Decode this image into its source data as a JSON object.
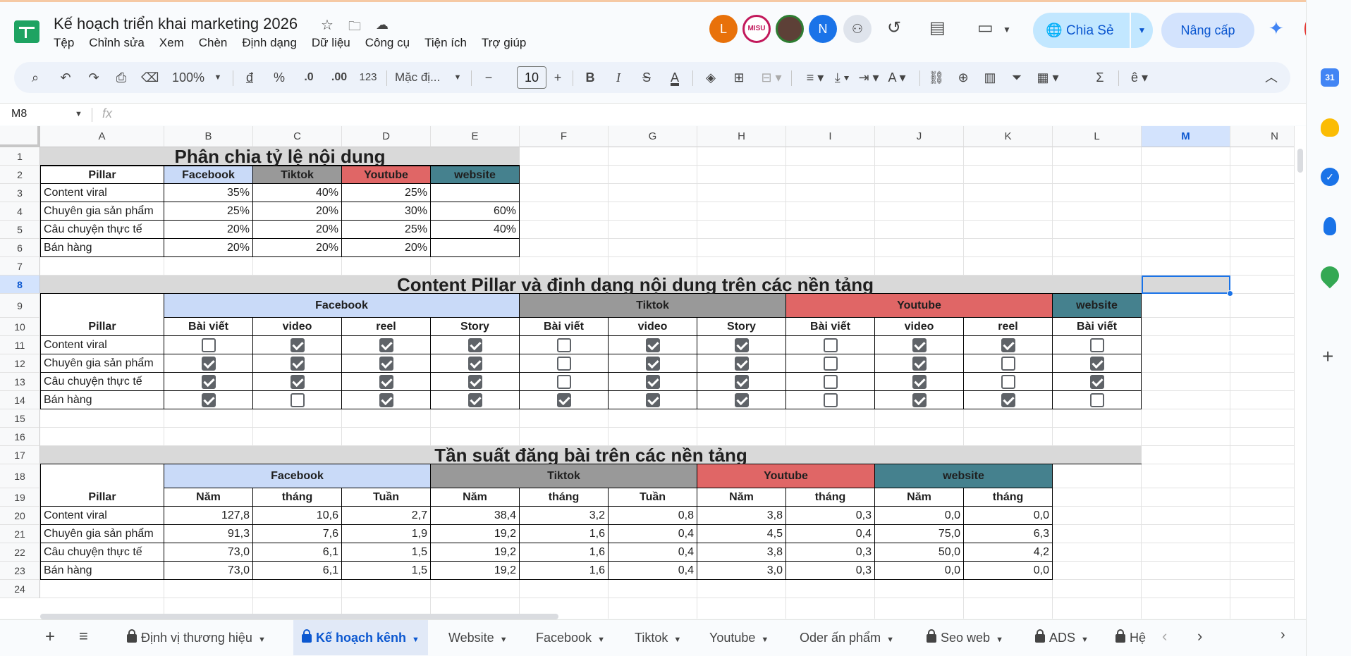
{
  "doc": {
    "title": "Kế hoạch triển khai marketing 2026"
  },
  "menu": [
    "Tệp",
    "Chỉnh sửa",
    "Xem",
    "Chèn",
    "Định dạng",
    "Dữ liệu",
    "Công cụ",
    "Tiện ích",
    "Trợ giúp"
  ],
  "avatars": [
    {
      "label": "L",
      "color": "#e8710a"
    },
    {
      "label": "MISU",
      "color": "#c2185b"
    },
    {
      "label": "",
      "color": "#5d4037"
    },
    {
      "label": "N",
      "color": "#1a73e8"
    }
  ],
  "share": {
    "label": "Chia Sẻ"
  },
  "upgrade": {
    "label": "Nâng cấp"
  },
  "toolbar": {
    "zoom": "100%",
    "currency": "đ",
    "percent": "%",
    "dec_less": ".0",
    "dec_more": ".00",
    "format123": "123",
    "font": "Mặc đị...",
    "font_size": "10"
  },
  "namebox": "M8",
  "fx": "fx",
  "columns": [
    "A",
    "B",
    "C",
    "D",
    "E",
    "F",
    "G",
    "H",
    "I",
    "J",
    "K",
    "L",
    "M",
    "N"
  ],
  "selected": {
    "col": "M",
    "row": "8"
  },
  "colors": {
    "facebook": "#c9daf8",
    "tiktok": "#999999",
    "youtube": "#e06666",
    "website": "#45818e",
    "title": "#d9d9d9",
    "accent": "#1a73e8"
  },
  "table1": {
    "title": "Phân chia tỷ lệ nội dung",
    "headers": [
      "Pillar",
      "Facebook",
      "Tiktok",
      "Youtube",
      "website"
    ],
    "rows": [
      [
        "Content viral",
        "35%",
        "40%",
        "25%",
        ""
      ],
      [
        "Chuyên gia sản phẩm",
        "25%",
        "20%",
        "30%",
        "60%"
      ],
      [
        "Câu chuyện thực tế",
        "20%",
        "20%",
        "25%",
        "40%"
      ],
      [
        "Bán hàng",
        "20%",
        "20%",
        "20%",
        ""
      ]
    ]
  },
  "table2": {
    "title": "Content Pillar và định dạng nội dung trên các nền tảng",
    "pillar": "Pillar",
    "platforms": [
      "Facebook",
      "Tiktok",
      "Youtube",
      "website"
    ],
    "formats": [
      "Bài viết",
      "video",
      "reel",
      "Story",
      "Bài viết",
      "video",
      "Story",
      "Bài viết",
      "video",
      "reel",
      "Bài viết"
    ],
    "rows": [
      {
        "label": "Content viral",
        "checks": [
          0,
          1,
          1,
          1,
          0,
          1,
          1,
          0,
          1,
          1,
          0
        ]
      },
      {
        "label": "Chuyên gia sản phẩm",
        "checks": [
          1,
          1,
          1,
          1,
          0,
          1,
          1,
          0,
          1,
          0,
          1
        ]
      },
      {
        "label": "Câu chuyện thực tế",
        "checks": [
          1,
          1,
          1,
          1,
          0,
          1,
          1,
          0,
          1,
          0,
          1
        ]
      },
      {
        "label": "Bán hàng",
        "checks": [
          1,
          0,
          1,
          1,
          1,
          1,
          1,
          0,
          1,
          1,
          0
        ]
      }
    ]
  },
  "table3": {
    "title": "Tần suất đăng bài trên các nền tảng",
    "pillar": "Pillar",
    "platforms": [
      "Facebook",
      "Tiktok",
      "Youtube",
      "website"
    ],
    "periods": [
      "Năm",
      "tháng",
      "Tuần",
      "Năm",
      "tháng",
      "Tuần",
      "Năm",
      "tháng",
      "Năm",
      "tháng"
    ],
    "rows": [
      {
        "label": "Content viral",
        "values": [
          "127,8",
          "10,6",
          "2,7",
          "38,4",
          "3,2",
          "0,8",
          "3,8",
          "0,3",
          "0,0",
          "0,0"
        ]
      },
      {
        "label": "Chuyên gia sản phẩm",
        "values": [
          "91,3",
          "7,6",
          "1,9",
          "19,2",
          "1,6",
          "0,4",
          "4,5",
          "0,4",
          "75,0",
          "6,3"
        ]
      },
      {
        "label": "Câu chuyện thực tế",
        "values": [
          "73,0",
          "6,1",
          "1,5",
          "19,2",
          "1,6",
          "0,4",
          "3,8",
          "0,3",
          "50,0",
          "4,2"
        ]
      },
      {
        "label": "Bán hàng",
        "values": [
          "73,0",
          "6,1",
          "1,5",
          "19,2",
          "1,6",
          "0,4",
          "3,0",
          "0,3",
          "0,0",
          "0,0"
        ]
      }
    ]
  },
  "tabs": [
    {
      "label": "Định vị thương hiệu",
      "locked": true,
      "active": false
    },
    {
      "label": "Kế hoạch kênh",
      "locked": true,
      "active": true
    },
    {
      "label": "Website",
      "locked": false,
      "active": false
    },
    {
      "label": "Facebook",
      "locked": false,
      "active": false
    },
    {
      "label": "Tiktok",
      "locked": false,
      "active": false
    },
    {
      "label": "Youtube",
      "locked": false,
      "active": false
    },
    {
      "label": "Oder ấn phẩm",
      "locked": false,
      "active": false
    },
    {
      "label": "Seo web",
      "locked": true,
      "active": false
    },
    {
      "label": "ADS",
      "locked": true,
      "active": false
    },
    {
      "label": "Hệ",
      "locked": true,
      "active": false
    }
  ],
  "side": {
    "calendar_day": "31"
  }
}
